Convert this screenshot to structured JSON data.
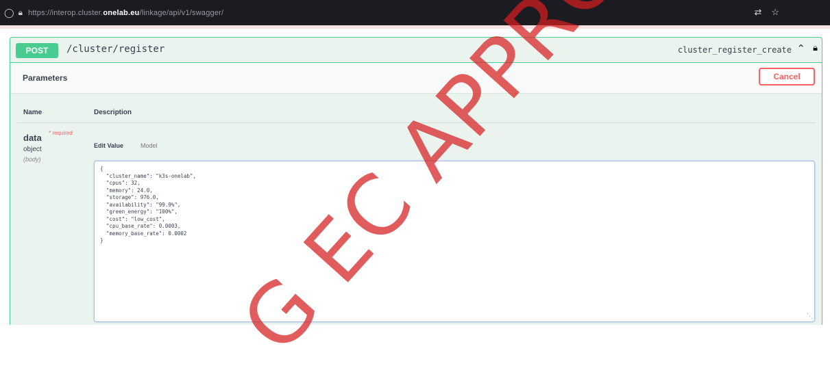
{
  "browser": {
    "url_prefix": "https://interop.cluster.",
    "url_host": "onelab.eu",
    "url_suffix": "/linkage/api/v1/swagger/"
  },
  "operation": {
    "method": "POST",
    "path": "/cluster/register",
    "operation_id": "cluster_register_create"
  },
  "parameters": {
    "title": "Parameters",
    "cancel_label": "Cancel",
    "col_name": "Name",
    "col_description": "Description",
    "param": {
      "name": "data",
      "required": "* required",
      "type": "object",
      "in": "(body)"
    },
    "tabs": {
      "edit": "Edit Value",
      "model": "Model"
    },
    "body_value": "{\n  \"cluster_name\": \"k3s-onelab\",\n  \"cpus\": 32,\n  \"memory\": 24.0,\n  \"storage\": 976.0,\n  \"availability\": \"99.9%\",\n  \"green_energy\": \"100%\",\n  \"cost\": \"low_cost\",\n  \"cpu_base_rate\": 0.0003,\n  \"memory_base_rate\": 0.0002\n}"
  },
  "watermark": "G EC APPRO",
  "colors": {
    "post_green": "#49cc90",
    "cancel_red": "#ff6060",
    "watermark_red": "#d61e1e"
  }
}
